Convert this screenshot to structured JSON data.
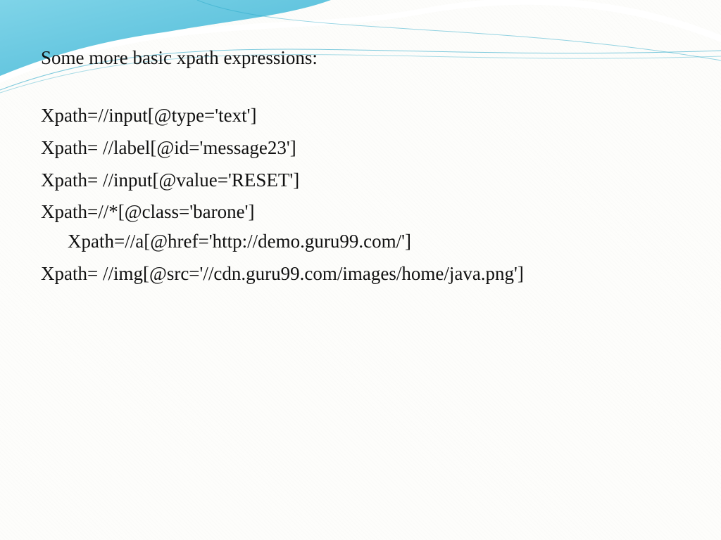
{
  "slide": {
    "title": "Some more basic xpath expressions:",
    "lines": {
      "l1": "Xpath=//input[@type='text']",
      "l2": "Xpath= //label[@id='message23']",
      "l3": "Xpath= //input[@value='RESET']",
      "l4a": "Xpath=//*[@class='barone']",
      "l4b": "Xpath=//a[@href='http://demo.guru99.com/']",
      "l5": "Xpath= //img[@src='//cdn.guru99.com/images/home/java.png']"
    }
  }
}
